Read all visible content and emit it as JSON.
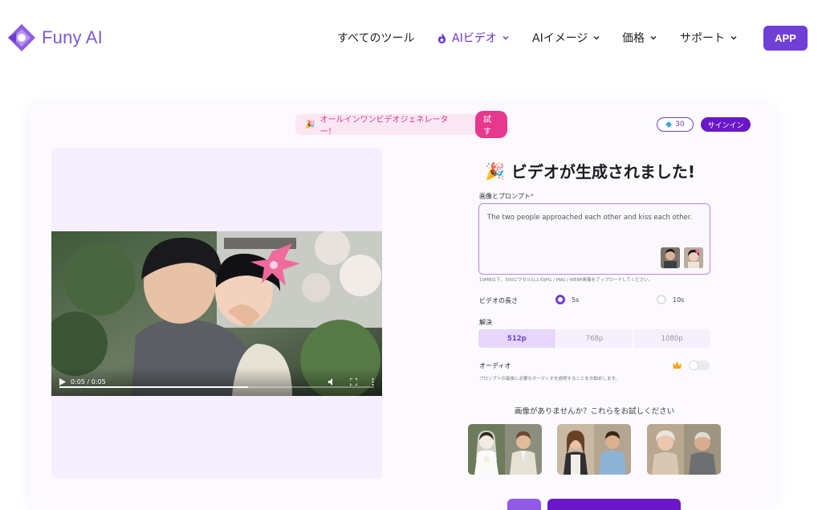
{
  "header": {
    "logo_text": "Funy AI",
    "nav": [
      {
        "label": "すべてのツール",
        "active": false,
        "has_chevron": false
      },
      {
        "label": "AIビデオ",
        "active": true,
        "has_chevron": true,
        "icon": "flame-icon"
      },
      {
        "label": "AIイメージ",
        "active": false,
        "has_chevron": true
      },
      {
        "label": "価格",
        "active": false,
        "has_chevron": true
      },
      {
        "label": "サポート",
        "active": false,
        "has_chevron": true
      }
    ],
    "app_button": "APP",
    "accent": "#6f3fd6"
  },
  "promo": {
    "text": "オールインワンビデオジェネレーター！",
    "try_label": "試す"
  },
  "account": {
    "credits": "30",
    "signin_label": "サインイン"
  },
  "video": {
    "time": "0:05 / 0:05",
    "progress": 0.6
  },
  "form": {
    "title": "ビデオが生成されました!",
    "image_prompt_label": "画像とプロンプト",
    "required_mark": "*",
    "prompt_value": "The two people approached each other and kiss each other.",
    "upload_hint": "10MB以下、300ピクセル以上のJPG / PNG / WEBP画像をアップロードしてください。",
    "duration_label": "ビデオの長さ",
    "durations": [
      {
        "label": "5s",
        "selected": true
      },
      {
        "label": "10s",
        "selected": false
      }
    ],
    "resolution_label": "解決",
    "resolutions": [
      {
        "label": "512p",
        "selected": true
      },
      {
        "label": "768p",
        "selected": false
      },
      {
        "label": "1080p",
        "selected": false
      }
    ],
    "audio_label": "オーディオ",
    "audio_desc": "プロンプトの最後に必要なオーディオを説明することをお勧めします。",
    "audio_enabled": false,
    "samples_title": "画像がありませんか？これらをお試しください"
  }
}
